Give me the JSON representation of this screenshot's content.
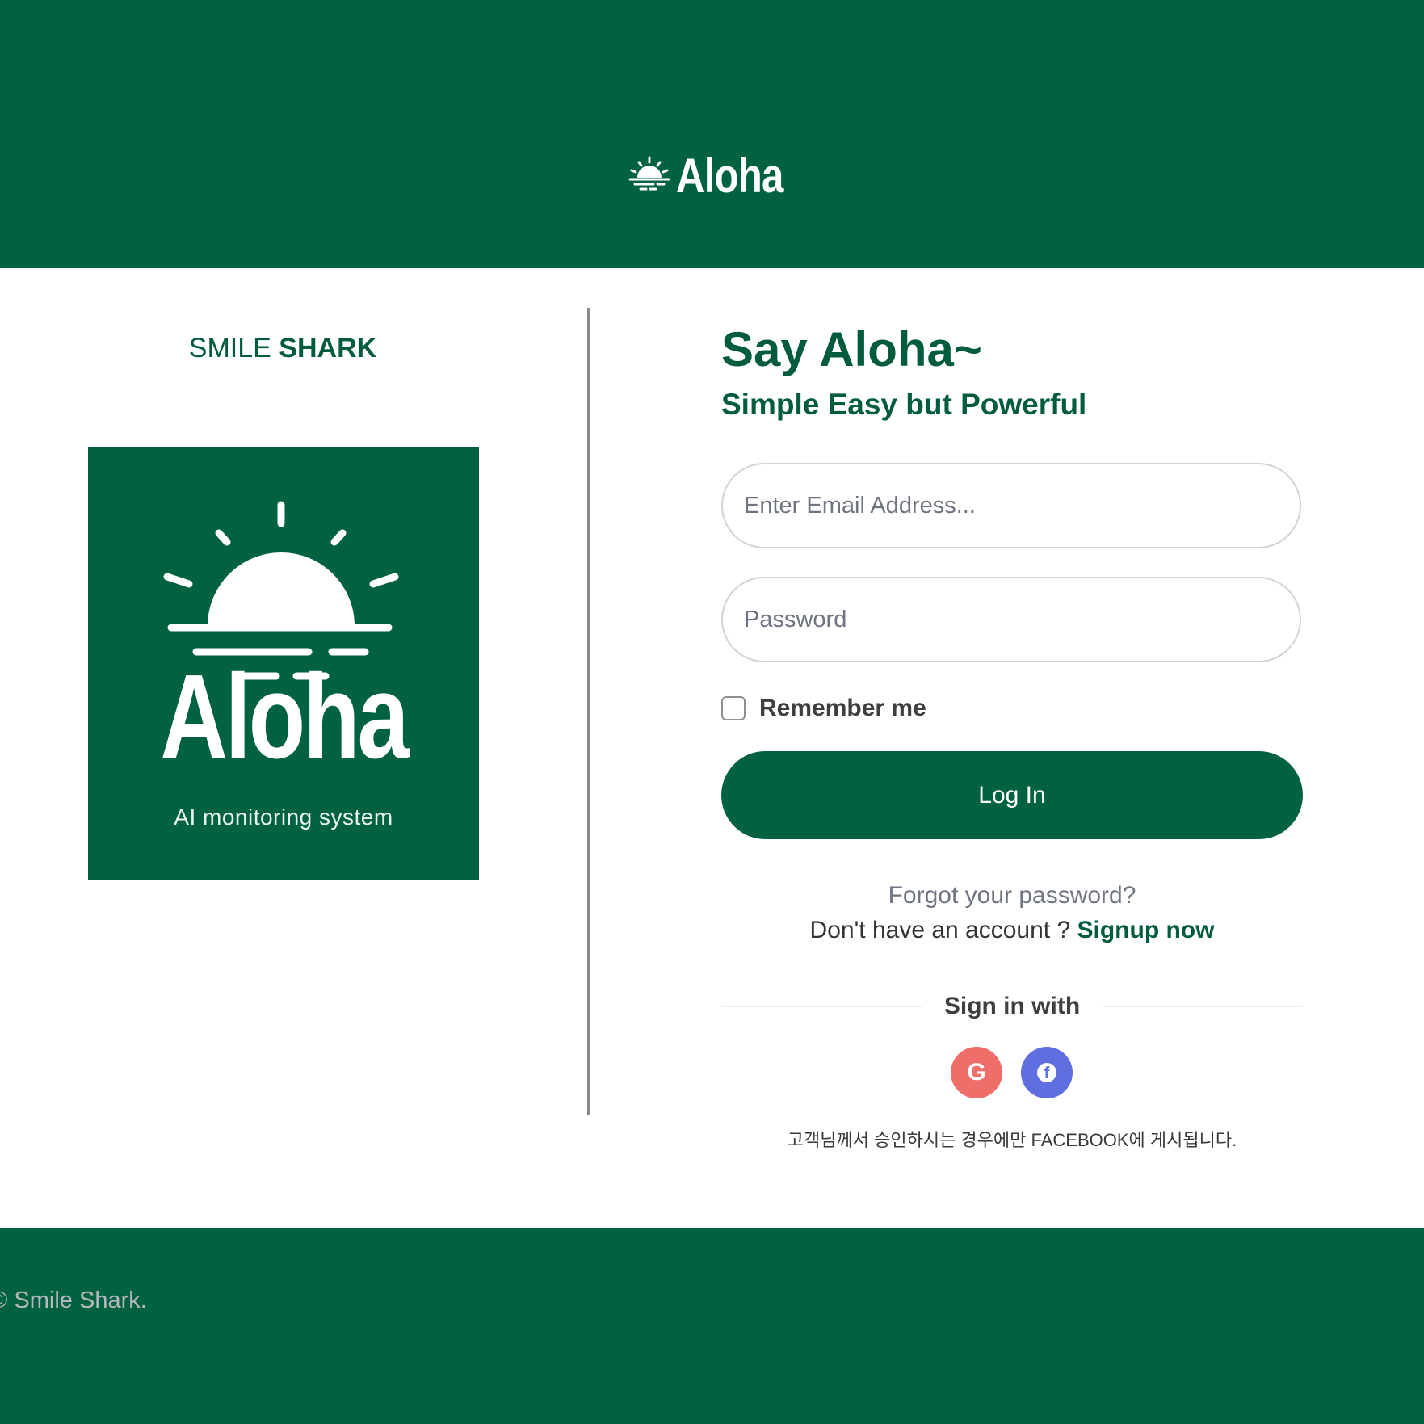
{
  "header": {
    "brand": "Aloha",
    "logo_icon": "sunrise-icon"
  },
  "left": {
    "company_part1": "SMILE",
    "company_part2": "SHARK",
    "logo": {
      "icon": "sunrise-icon",
      "brand": "Aloha",
      "tagline": "AI monitoring system"
    }
  },
  "login": {
    "title": "Say Aloha~",
    "subtitle": "Simple Easy but Powerful",
    "email_placeholder": "Enter Email Address...",
    "password_placeholder": "Password",
    "remember_label": "Remember me",
    "remember_checked": false,
    "button_label": "Log In",
    "forgot": "Forgot your password?",
    "no_account": "Don't have an account ?",
    "signup": "Signup now",
    "sign_in_with": "Sign in with",
    "social": [
      {
        "name": "Google",
        "icon": "google-icon",
        "glyph": "G",
        "color": "#ee6e6a"
      },
      {
        "name": "Facebook",
        "icon": "facebook-icon",
        "glyph": "f",
        "color": "#5f6fe0"
      }
    ],
    "notice": "고객님께서 승인하시는 경우에만 FACEBOOK에 게시됩니다."
  },
  "footer": {
    "copyright": "© Smile Shark."
  },
  "colors": {
    "brand_green": "#006241",
    "text_green": "#005c3c",
    "muted": "#6f7481"
  }
}
